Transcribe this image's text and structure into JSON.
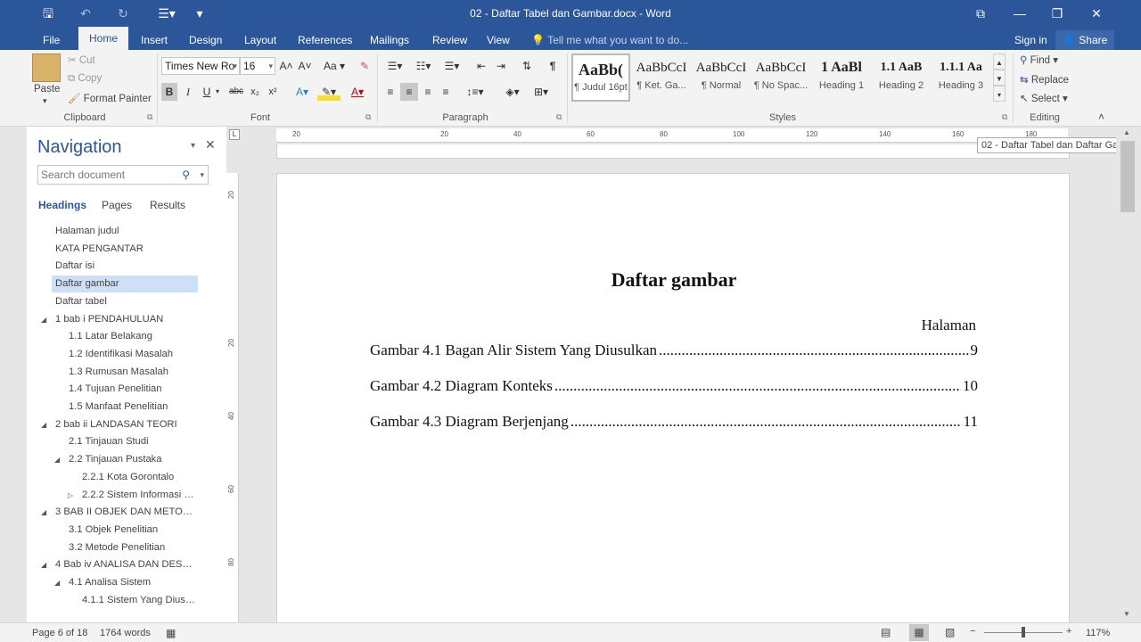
{
  "app": {
    "title": "02 - Daftar Tabel dan Gambar.docx - Word"
  },
  "quick_access": {
    "save": "🖫",
    "undo": "↶",
    "redo": "↻",
    "customize": "▾"
  },
  "window": {
    "ribbon_display": "⧉",
    "restore": "❐",
    "close": "✕"
  },
  "tabs": [
    {
      "label": "File"
    },
    {
      "label": "Home"
    },
    {
      "label": "Insert"
    },
    {
      "label": "Design"
    },
    {
      "label": "Layout"
    },
    {
      "label": "References"
    },
    {
      "label": "Mailings"
    },
    {
      "label": "Review"
    },
    {
      "label": "View"
    }
  ],
  "tell_me": "Tell me what you want to do...",
  "account": {
    "signin": "Sign in",
    "share": "Share"
  },
  "clipboard": {
    "paste": "Paste",
    "cut": "Cut",
    "copy": "Copy",
    "format_painter": "Format Painter",
    "group": "Clipboard"
  },
  "font": {
    "name": "Times New Ro",
    "size": "16",
    "group": "Font",
    "bold": "B",
    "italic": "I",
    "underline": "U",
    "strike": "abc",
    "sub": "x₂",
    "sup": "x²",
    "grow": "A˄",
    "shrink": "A˅",
    "case": "Aa",
    "clear": "A"
  },
  "paragraph": {
    "group": "Paragraph",
    "pilcrow": "¶"
  },
  "styles": {
    "group": "Styles",
    "items": [
      {
        "sample": "AaBb(",
        "name": "¶ Judul 16pt"
      },
      {
        "sample": "AaBbCcI",
        "name": "¶ Ket. Ga..."
      },
      {
        "sample": "AaBbCcI",
        "name": "¶ Normal"
      },
      {
        "sample": "AaBbCcI",
        "name": "¶ No Spac..."
      },
      {
        "sample": "1  AaBl",
        "name": "Heading 1"
      },
      {
        "sample": "1.1  AaB",
        "name": "Heading 2"
      },
      {
        "sample": "1.1.1  Aa",
        "name": "Heading 3"
      }
    ]
  },
  "editing": {
    "group": "Editing",
    "find": "Find",
    "replace": "Replace",
    "select": "Select"
  },
  "navigation": {
    "title": "Navigation",
    "search_placeholder": "Search document",
    "tabs": [
      "Headings",
      "Pages",
      "Results"
    ],
    "items": [
      {
        "label": "Halaman judul",
        "level": 1,
        "toggle": ""
      },
      {
        "label": "KATA PENGANTAR",
        "level": 1,
        "toggle": ""
      },
      {
        "label": "Daftar isi",
        "level": 1,
        "toggle": ""
      },
      {
        "label": "Daftar gambar",
        "level": 1,
        "toggle": "",
        "selected": true
      },
      {
        "label": "Daftar tabel",
        "level": 1,
        "toggle": ""
      },
      {
        "label": "1 bab i PENDAHULUAN",
        "level": 1,
        "toggle": "◢"
      },
      {
        "label": "1.1 Latar Belakang",
        "level": 2,
        "toggle": ""
      },
      {
        "label": "1.2 Identifikasi Masalah",
        "level": 2,
        "toggle": ""
      },
      {
        "label": "1.3 Rumusan Masalah",
        "level": 2,
        "toggle": ""
      },
      {
        "label": "1.4 Tujuan Penelitian",
        "level": 2,
        "toggle": ""
      },
      {
        "label": "1.5 Manfaat Penelitian",
        "level": 2,
        "toggle": ""
      },
      {
        "label": "2 bab ii LANDASAN TEORI",
        "level": 1,
        "toggle": "◢"
      },
      {
        "label": "2.1 Tinjauan Studi",
        "level": 2,
        "toggle": ""
      },
      {
        "label": "2.2 Tinjauan Pustaka",
        "level": 2,
        "toggle": "◢"
      },
      {
        "label": "2.2.1 Kota Gorontalo",
        "level": 3,
        "toggle": ""
      },
      {
        "label": "2.2.2 Sistem Informasi G...",
        "level": 3,
        "toggle": "▷"
      },
      {
        "label": "3 BAB II OBJEK DAN METODE...",
        "level": 1,
        "toggle": "◢"
      },
      {
        "label": "3.1 Objek Penelitian",
        "level": 2,
        "toggle": ""
      },
      {
        "label": "3.2 Metode Penelitian",
        "level": 2,
        "toggle": ""
      },
      {
        "label": "4 Bab iv ANALISA DAN DESAI...",
        "level": 1,
        "toggle": "◢"
      },
      {
        "label": "4.1 Analisa Sistem",
        "level": 2,
        "toggle": "◢"
      },
      {
        "label": "4.1.1 Sistem Yang Diusul...",
        "level": 3,
        "toggle": ""
      }
    ]
  },
  "ruler": {
    "h_labels": [
      "20",
      "20",
      "40",
      "60",
      "80",
      "100",
      "120",
      "140",
      "160",
      "180"
    ],
    "v_labels": [
      "20",
      "20",
      "40",
      "60",
      "80"
    ]
  },
  "document": {
    "title": "Daftar gambar",
    "page_header": "Halaman",
    "entries": [
      {
        "text": "Gambar 4.1 Bagan Alir Sistem Yang Diusulkan",
        "page": "9"
      },
      {
        "text": "Gambar 4.2 Diagram Konteks",
        "page": "10"
      },
      {
        "text": "Gambar 4.3 Diagram Berjenjang",
        "page": "11"
      }
    ]
  },
  "tooltip": "02 - Daftar Tabel dan Daftar Ga",
  "status": {
    "page": "Page 6 of 18",
    "words": "1764 words",
    "zoom": "117%",
    "minus": "−",
    "plus": "+"
  },
  "colors": {
    "brand": "#2b579a",
    "selected": "#cde0f7"
  }
}
